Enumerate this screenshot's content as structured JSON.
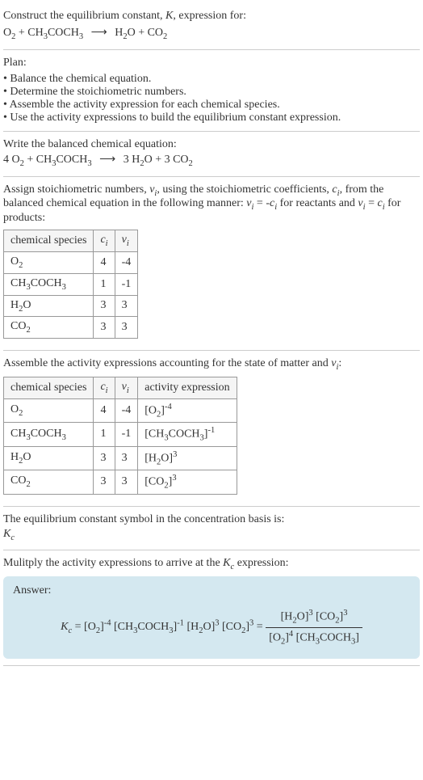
{
  "header": {
    "line1": "Construct the equilibrium constant, K, expression for:",
    "equation": "O₂ + CH₃COCH₃ ⟶ H₂O + CO₂"
  },
  "plan": {
    "title": "Plan:",
    "items": [
      "• Balance the chemical equation.",
      "• Determine the stoichiometric numbers.",
      "• Assemble the activity expression for each chemical species.",
      "• Use the activity expressions to build the equilibrium constant expression."
    ]
  },
  "balanced": {
    "title": "Write the balanced chemical equation:",
    "equation": "4 O₂ + CH₃COCH₃ ⟶ 3 H₂O + 3 CO₂"
  },
  "assign": {
    "text": "Assign stoichiometric numbers, νᵢ, using the stoichiometric coefficients, cᵢ, from the balanced chemical equation in the following manner: νᵢ = -cᵢ for reactants and νᵢ = cᵢ for products:",
    "headers": [
      "chemical species",
      "cᵢ",
      "νᵢ"
    ],
    "rows": [
      [
        "O₂",
        "4",
        "-4"
      ],
      [
        "CH₃COCH₃",
        "1",
        "-1"
      ],
      [
        "H₂O",
        "3",
        "3"
      ],
      [
        "CO₂",
        "3",
        "3"
      ]
    ]
  },
  "assemble": {
    "title": "Assemble the activity expressions accounting for the state of matter and νᵢ:",
    "headers": [
      "chemical species",
      "cᵢ",
      "νᵢ",
      "activity expression"
    ],
    "rows": [
      [
        "O₂",
        "4",
        "-4",
        "[O₂]⁻⁴"
      ],
      [
        "CH₃COCH₃",
        "1",
        "-1",
        "[CH₃COCH₃]⁻¹"
      ],
      [
        "H₂O",
        "3",
        "3",
        "[H₂O]³"
      ],
      [
        "CO₂",
        "3",
        "3",
        "[CO₂]³"
      ]
    ]
  },
  "symbol": {
    "title": "The equilibrium constant symbol in the concentration basis is:",
    "value": "K_c"
  },
  "multiply": {
    "title": "Mulitply the activity expressions to arrive at the K_c expression:"
  },
  "answer": {
    "label": "Answer:",
    "lhs": "K_c = [O₂]⁻⁴ [CH₃COCH₃]⁻¹ [H₂O]³ [CO₂]³ = ",
    "numerator": "[H₂O]³ [CO₂]³",
    "denominator": "[O₂]⁴ [CH₃COCH₃]"
  }
}
